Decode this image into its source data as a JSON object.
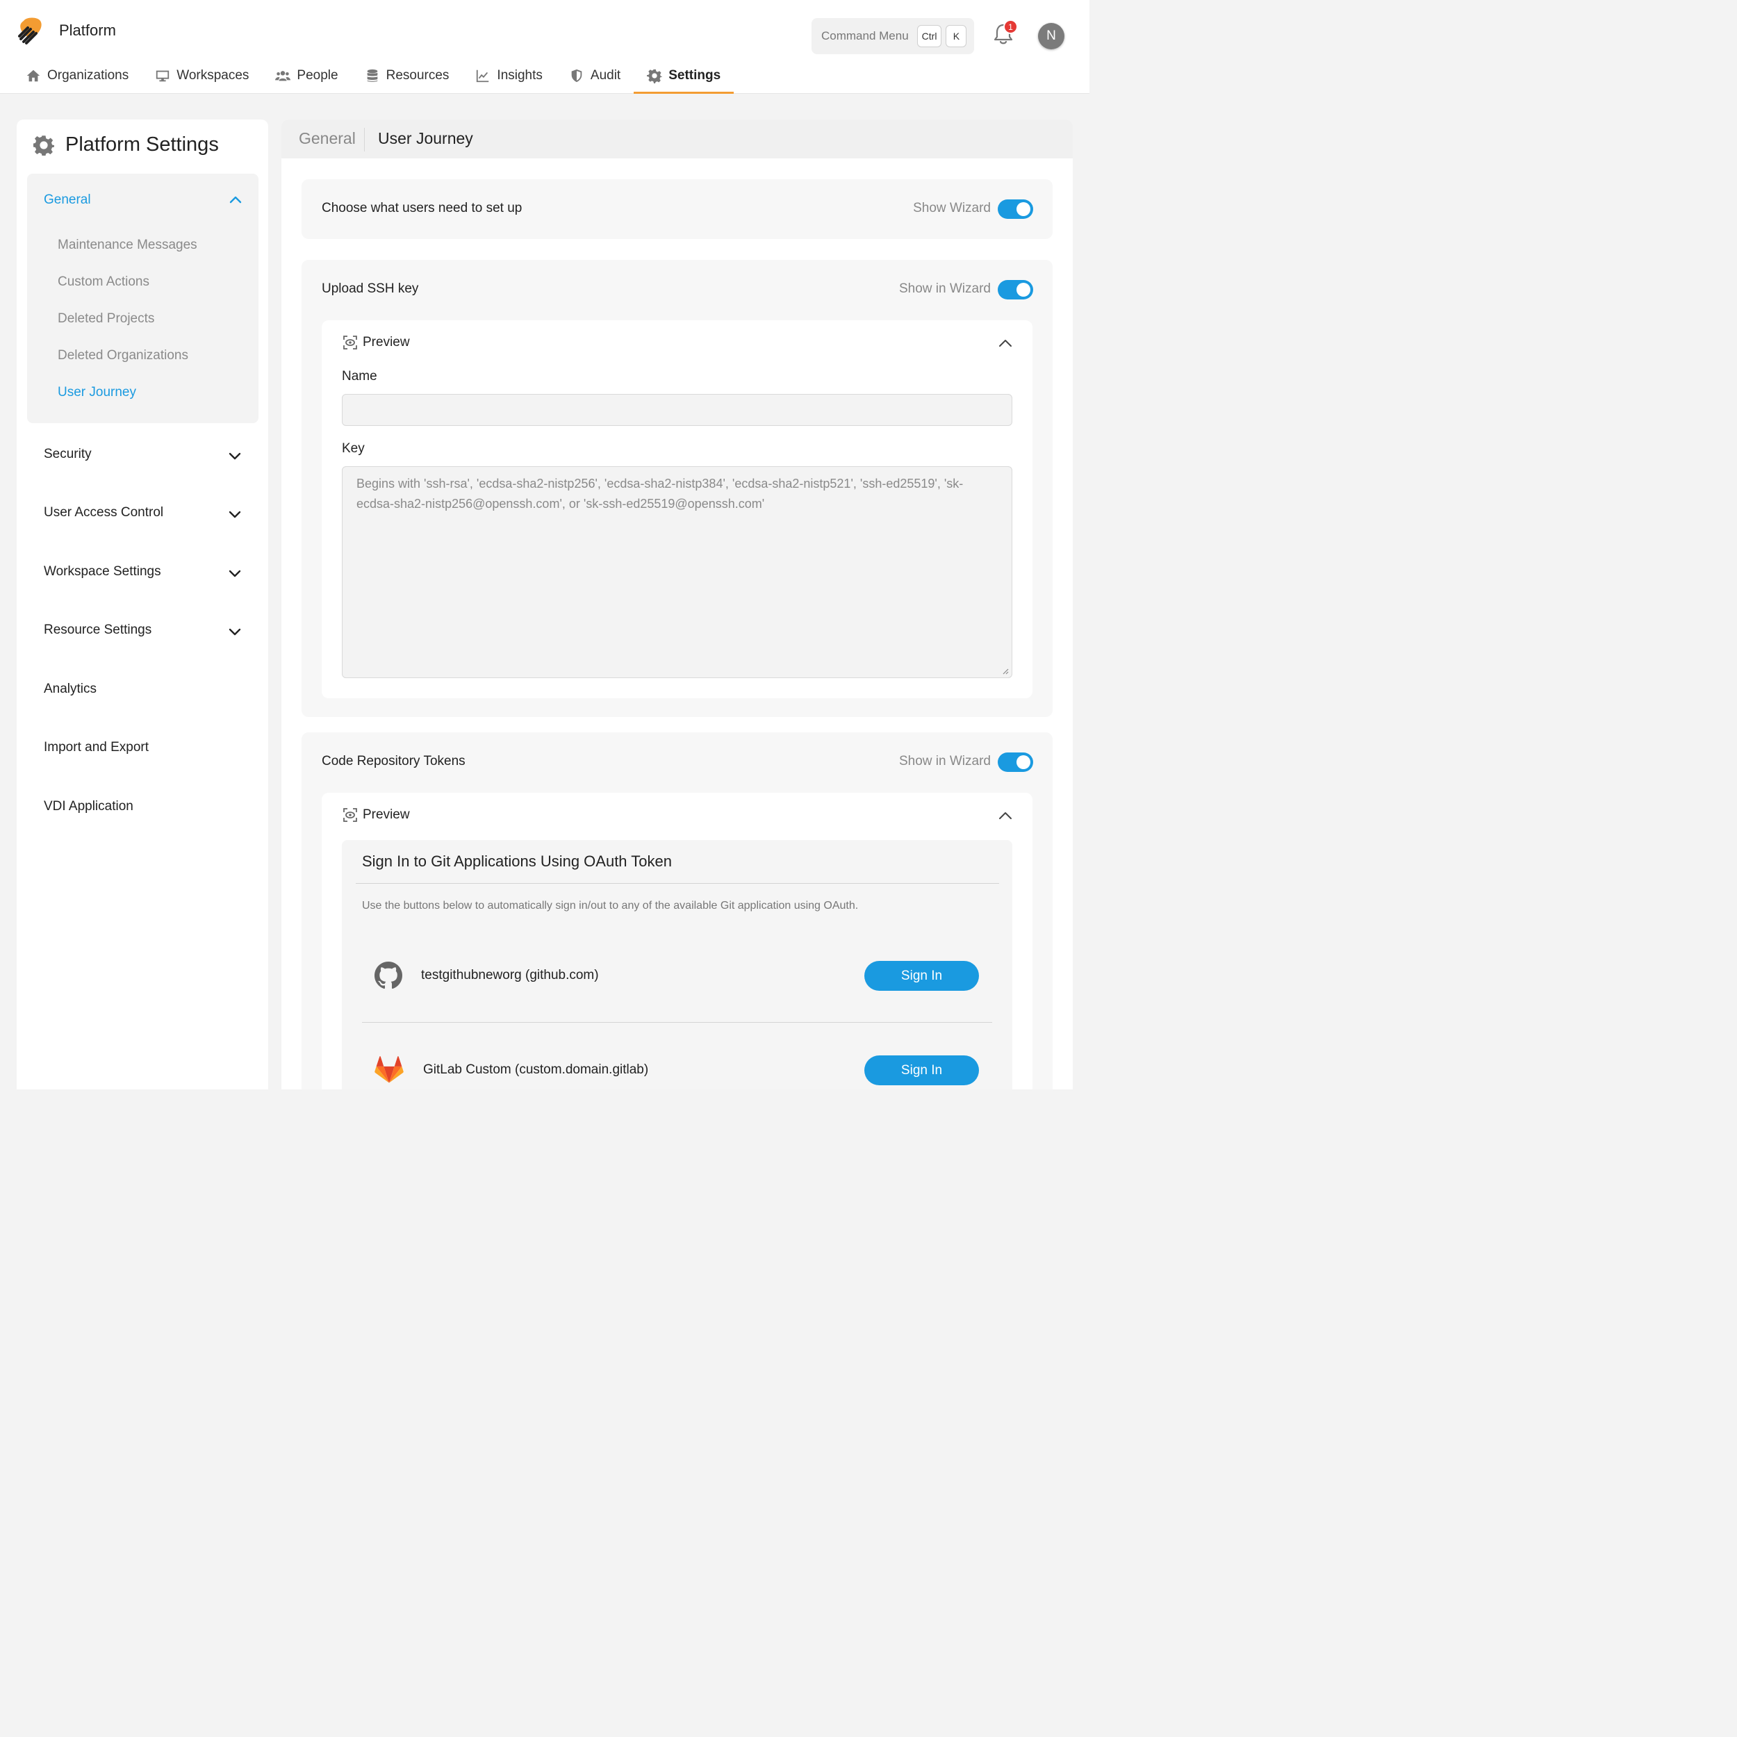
{
  "header": {
    "app_title": "Platform",
    "command_menu": {
      "label": "Command Menu",
      "key1": "Ctrl",
      "key2": "K"
    },
    "notifications_count": "1",
    "avatar_initial": "N"
  },
  "nav": {
    "items": [
      {
        "label": "Organizations",
        "icon": "home-icon"
      },
      {
        "label": "Workspaces",
        "icon": "monitor-icon"
      },
      {
        "label": "People",
        "icon": "people-icon"
      },
      {
        "label": "Resources",
        "icon": "database-icon"
      },
      {
        "label": "Insights",
        "icon": "chart-line-icon"
      },
      {
        "label": "Audit",
        "icon": "shield-icon"
      },
      {
        "label": "Settings",
        "icon": "gear-icon",
        "active": true
      }
    ]
  },
  "sidebar": {
    "title": "Platform Settings",
    "general": {
      "label": "General",
      "items": [
        "Maintenance Messages",
        "Custom Actions",
        "Deleted Projects",
        "Deleted Organizations",
        "User Journey"
      ],
      "active": "User Journey"
    },
    "sections": [
      "Security",
      "User Access Control",
      "Workspace Settings",
      "Resource Settings",
      "Analytics",
      "Import and Export",
      "VDI Application"
    ]
  },
  "main": {
    "tabs": {
      "general": "General",
      "user_journey": "User Journey"
    },
    "setup": {
      "title": "Choose what users need to set up",
      "toggle_label": "Show Wizard",
      "enabled": true
    },
    "ssh": {
      "title": "Upload SSH key",
      "toggle_label": "Show in Wizard",
      "enabled": true,
      "preview_label": "Preview",
      "name_label": "Name",
      "name_value": "",
      "key_label": "Key",
      "key_placeholder": "Begins with 'ssh-rsa', 'ecdsa-sha2-nistp256', 'ecdsa-sha2-nistp384', 'ecdsa-sha2-nistp521', 'ssh-ed25519', 'sk-ecdsa-sha2-nistp256@openssh.com', or 'sk-ssh-ed25519@openssh.com'"
    },
    "tokens": {
      "title": "Code Repository Tokens",
      "toggle_label": "Show in Wizard",
      "enabled": true,
      "preview_label": "Preview",
      "oauth_title": "Sign In to Git Applications Using OAuth Token",
      "oauth_desc": "Use the buttons below to automatically sign in/out to any of the available Git application using OAuth.",
      "providers": [
        {
          "name": "testgithubneworg (github.com)",
          "icon": "github-icon",
          "button": "Sign In"
        },
        {
          "name": "GitLab Custom (custom.domain.gitlab)",
          "icon": "gitlab-icon",
          "button": "Sign In"
        }
      ]
    }
  },
  "colors": {
    "accent": "#1a9ae0",
    "active_tab": "#f39c32",
    "badge": "#e53935"
  }
}
